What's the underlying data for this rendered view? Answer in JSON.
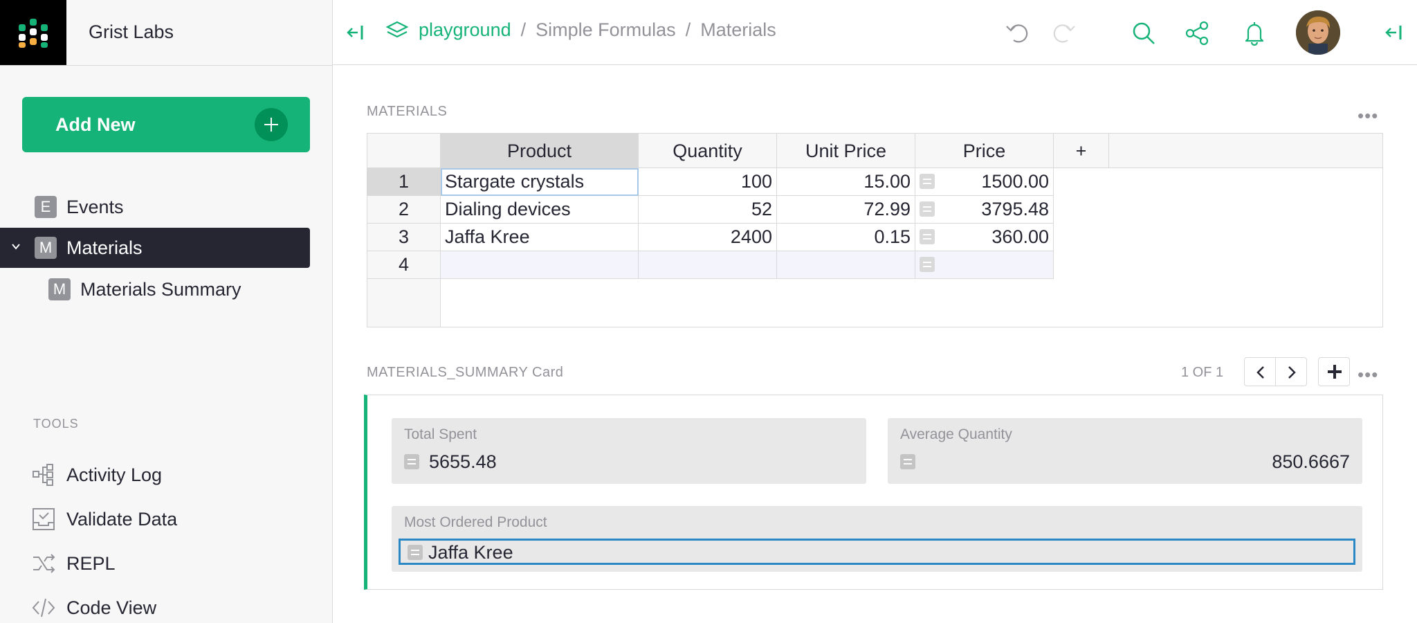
{
  "org": {
    "name": "Grist Labs"
  },
  "left_panel": {
    "add_new_label": "Add New",
    "pages": [
      {
        "icon_letter": "E",
        "label": "Events"
      },
      {
        "icon_letter": "M",
        "label": "Materials"
      },
      {
        "icon_letter": "M",
        "label": "Materials Summary"
      }
    ],
    "tools_label": "TOOLS",
    "tools": [
      {
        "icon": "activity-log-icon",
        "label": "Activity Log"
      },
      {
        "icon": "validate-data-icon",
        "label": "Validate Data"
      },
      {
        "icon": "repl-icon",
        "label": "REPL"
      },
      {
        "icon": "code-view-icon",
        "label": "Code View"
      }
    ]
  },
  "breadcrumb": {
    "workspace": "playground",
    "separator": "/",
    "document": "Simple Formulas",
    "page": "Materials"
  },
  "colors": {
    "accent": "#16b378",
    "dark": "#262633",
    "muted": "#929299",
    "cursor": "#2a89c4"
  },
  "materials": {
    "title": "MATERIALS",
    "menu": "•••",
    "add_column_label": "+",
    "columns": [
      "Product",
      "Quantity",
      "Unit Price",
      "Price"
    ],
    "rows": [
      {
        "n": "1",
        "product": "Stargate crystals",
        "quantity": "100",
        "unit_price": "15.00",
        "price": "1500.00"
      },
      {
        "n": "2",
        "product": "Dialing devices",
        "quantity": "52",
        "unit_price": "72.99",
        "price": "3795.48"
      },
      {
        "n": "3",
        "product": "Jaffa Kree",
        "quantity": "2400",
        "unit_price": "0.15",
        "price": "360.00"
      }
    ],
    "add_row_number": "4"
  },
  "summary_card": {
    "title": "MATERIALS_SUMMARY Card",
    "count": "1 OF 1",
    "menu": "•••",
    "fields": {
      "total_spent": {
        "label": "Total Spent",
        "value": "5655.48"
      },
      "average_quantity": {
        "label": "Average Quantity",
        "value": "850.6667"
      },
      "most_ordered": {
        "label": "Most Ordered Product",
        "value": "Jaffa Kree"
      }
    }
  }
}
